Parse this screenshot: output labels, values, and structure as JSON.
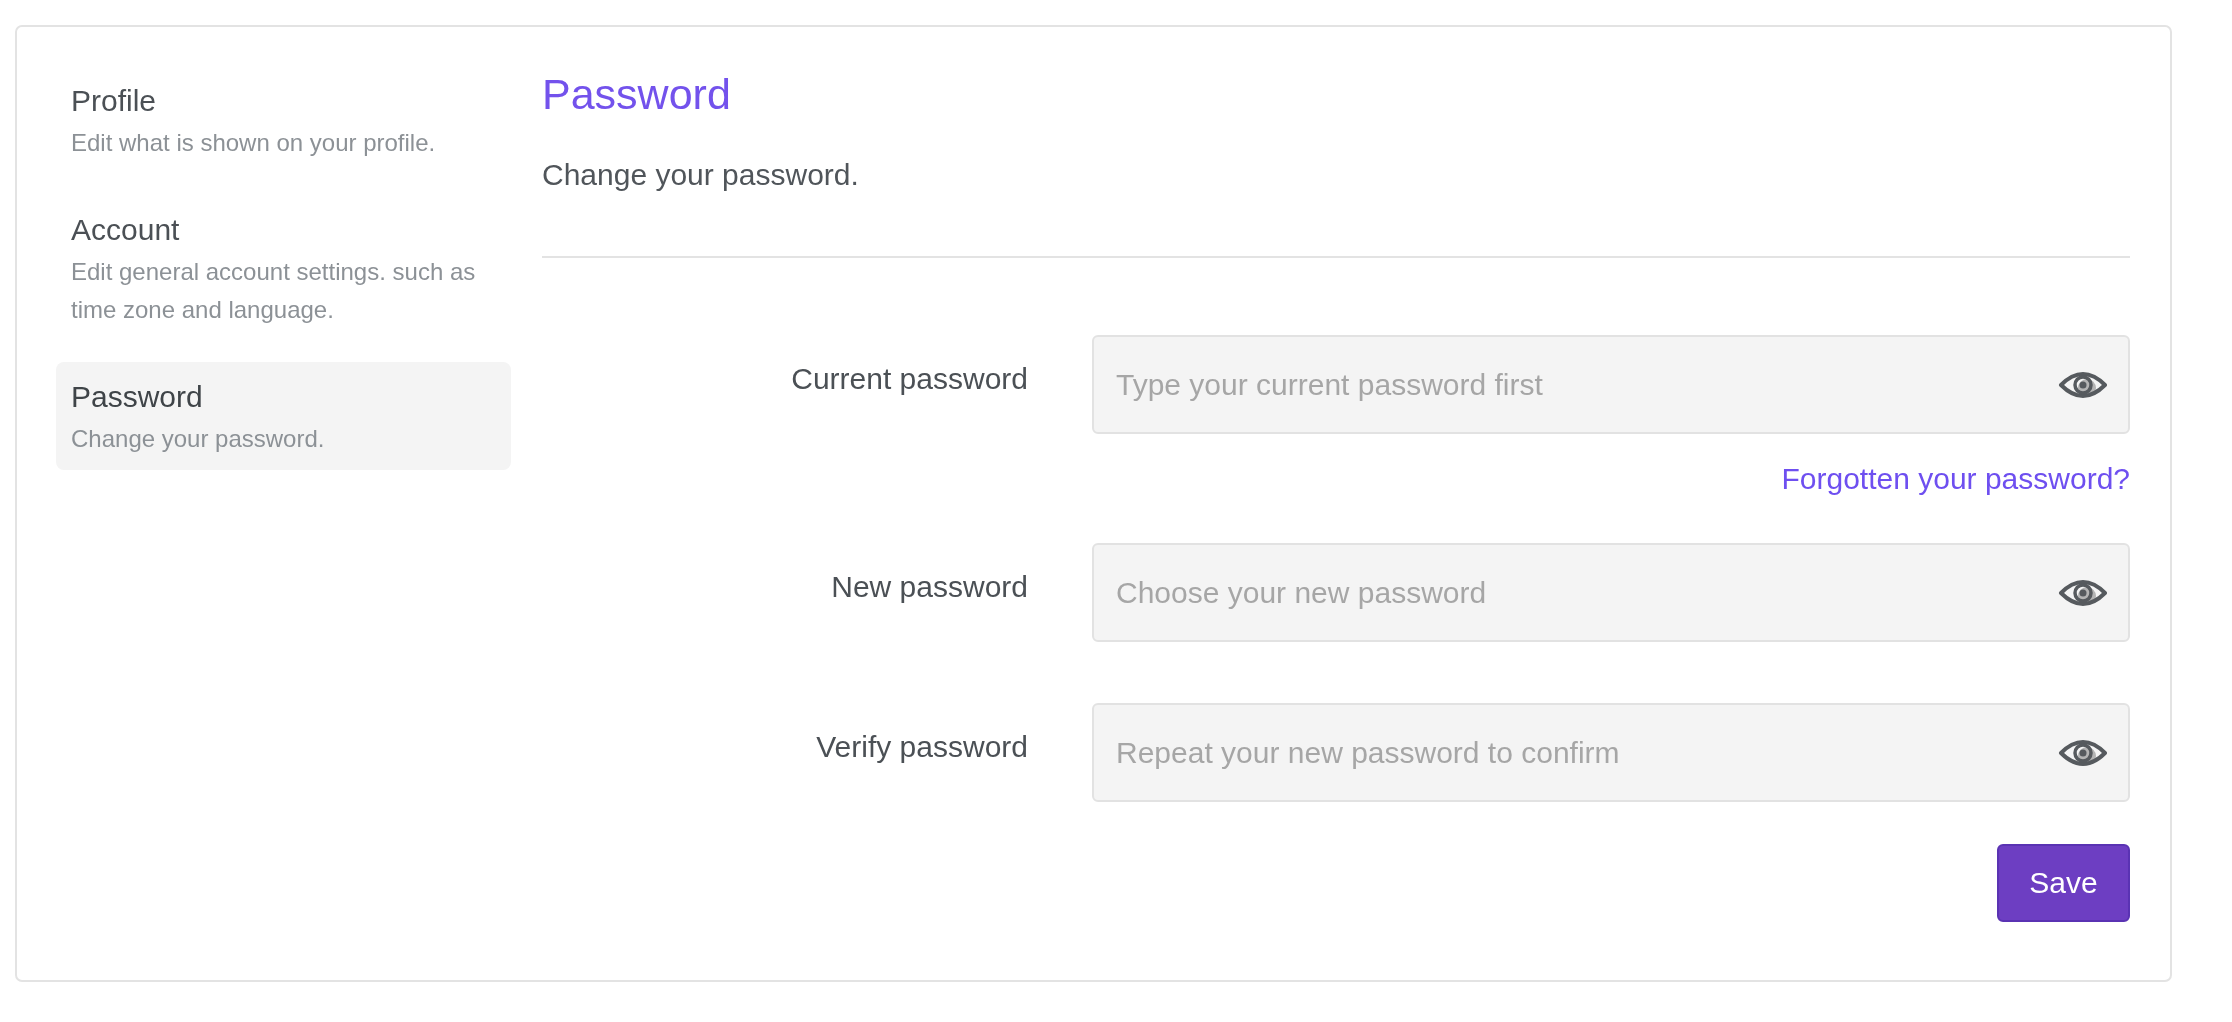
{
  "sidebar": {
    "items": [
      {
        "title": "Profile",
        "description": "Edit what is shown on your profile.",
        "selected": false
      },
      {
        "title": "Account",
        "description": "Edit general account settings. such as time zone and language.",
        "selected": false
      },
      {
        "title": "Password",
        "description": "Change your password.",
        "selected": true
      }
    ]
  },
  "header": {
    "title": "Password",
    "subtitle": "Change your password."
  },
  "form": {
    "fields": [
      {
        "label": "Current password",
        "placeholder": "Type your current password first",
        "link": "Forgotten your password?"
      },
      {
        "label": "New password",
        "placeholder": "Choose your new password"
      },
      {
        "label": "Verify password",
        "placeholder": "Repeat your new password to confirm"
      }
    ]
  },
  "save_button": {
    "label": "Save"
  }
}
